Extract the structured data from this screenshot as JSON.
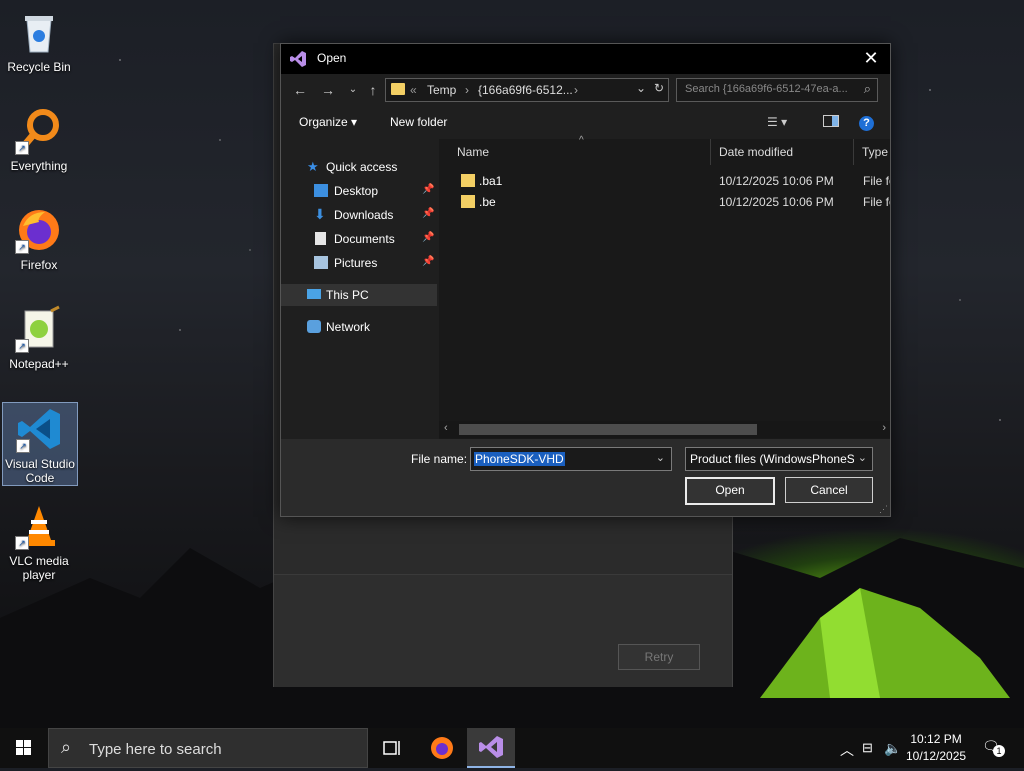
{
  "desktop": {
    "icons": [
      {
        "label": "Recycle Bin"
      },
      {
        "label": "Everything"
      },
      {
        "label": "Firefox"
      },
      {
        "label": "Notepad++"
      },
      {
        "label": "Visual Studio Code"
      },
      {
        "label": "VLC media player"
      }
    ]
  },
  "background_window": {
    "retry_label": "Retry"
  },
  "dialog": {
    "title": "Open",
    "close_glyph": "✕",
    "address": {
      "overflow": "«",
      "crumb1": "Temp",
      "crumb2": "{166a69f6-6512...",
      "sep": "›"
    },
    "search_placeholder": "Search {166a69f6-6512-47ea-a...",
    "toolbar": {
      "organize": "Organize ▾",
      "new_folder": "New folder",
      "help": "?"
    },
    "nav": {
      "quick_access": "Quick access",
      "desktop": "Desktop",
      "downloads": "Downloads",
      "documents": "Documents",
      "pictures": "Pictures",
      "this_pc": "This PC",
      "network": "Network"
    },
    "columns": {
      "name": "Name",
      "date": "Date modified",
      "type": "Type"
    },
    "files": [
      {
        "name": ".ba1",
        "date": "10/12/2025 10:06 PM",
        "type": "File folder"
      },
      {
        "name": ".be",
        "date": "10/12/2025 10:06 PM",
        "type": "File folder"
      }
    ],
    "file_name_label": "File name:",
    "file_name_value": "PhoneSDK-VHD",
    "filter_value": "Product files (WindowsPhoneSDK",
    "open_label": "Open",
    "cancel_label": "Cancel"
  },
  "taskbar": {
    "search_placeholder": "Type here to search",
    "time": "10:12 PM",
    "date": "10/12/2025",
    "notification_count": "1"
  }
}
